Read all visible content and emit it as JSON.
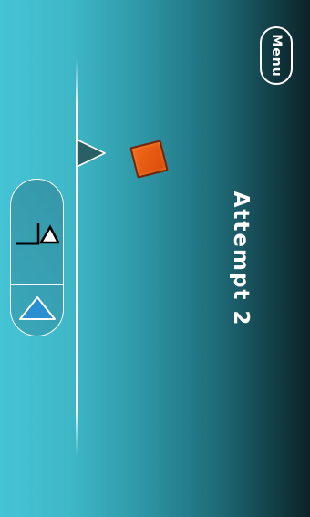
{
  "screen": {
    "background_start": "#45c4d5",
    "background_end": "#0c2228"
  },
  "hud": {
    "attempt_label": "Attempt 2",
    "menu_label": "Menu"
  },
  "player": {
    "color": "#e85a12",
    "shape": "cube"
  },
  "obstacle": {
    "type": "spike-icon",
    "color": "#2a5f66"
  },
  "controls": {
    "jump_icon": "jump-icon",
    "play_icon": "triangle-up-icon",
    "accent": "#2a8fd0"
  }
}
